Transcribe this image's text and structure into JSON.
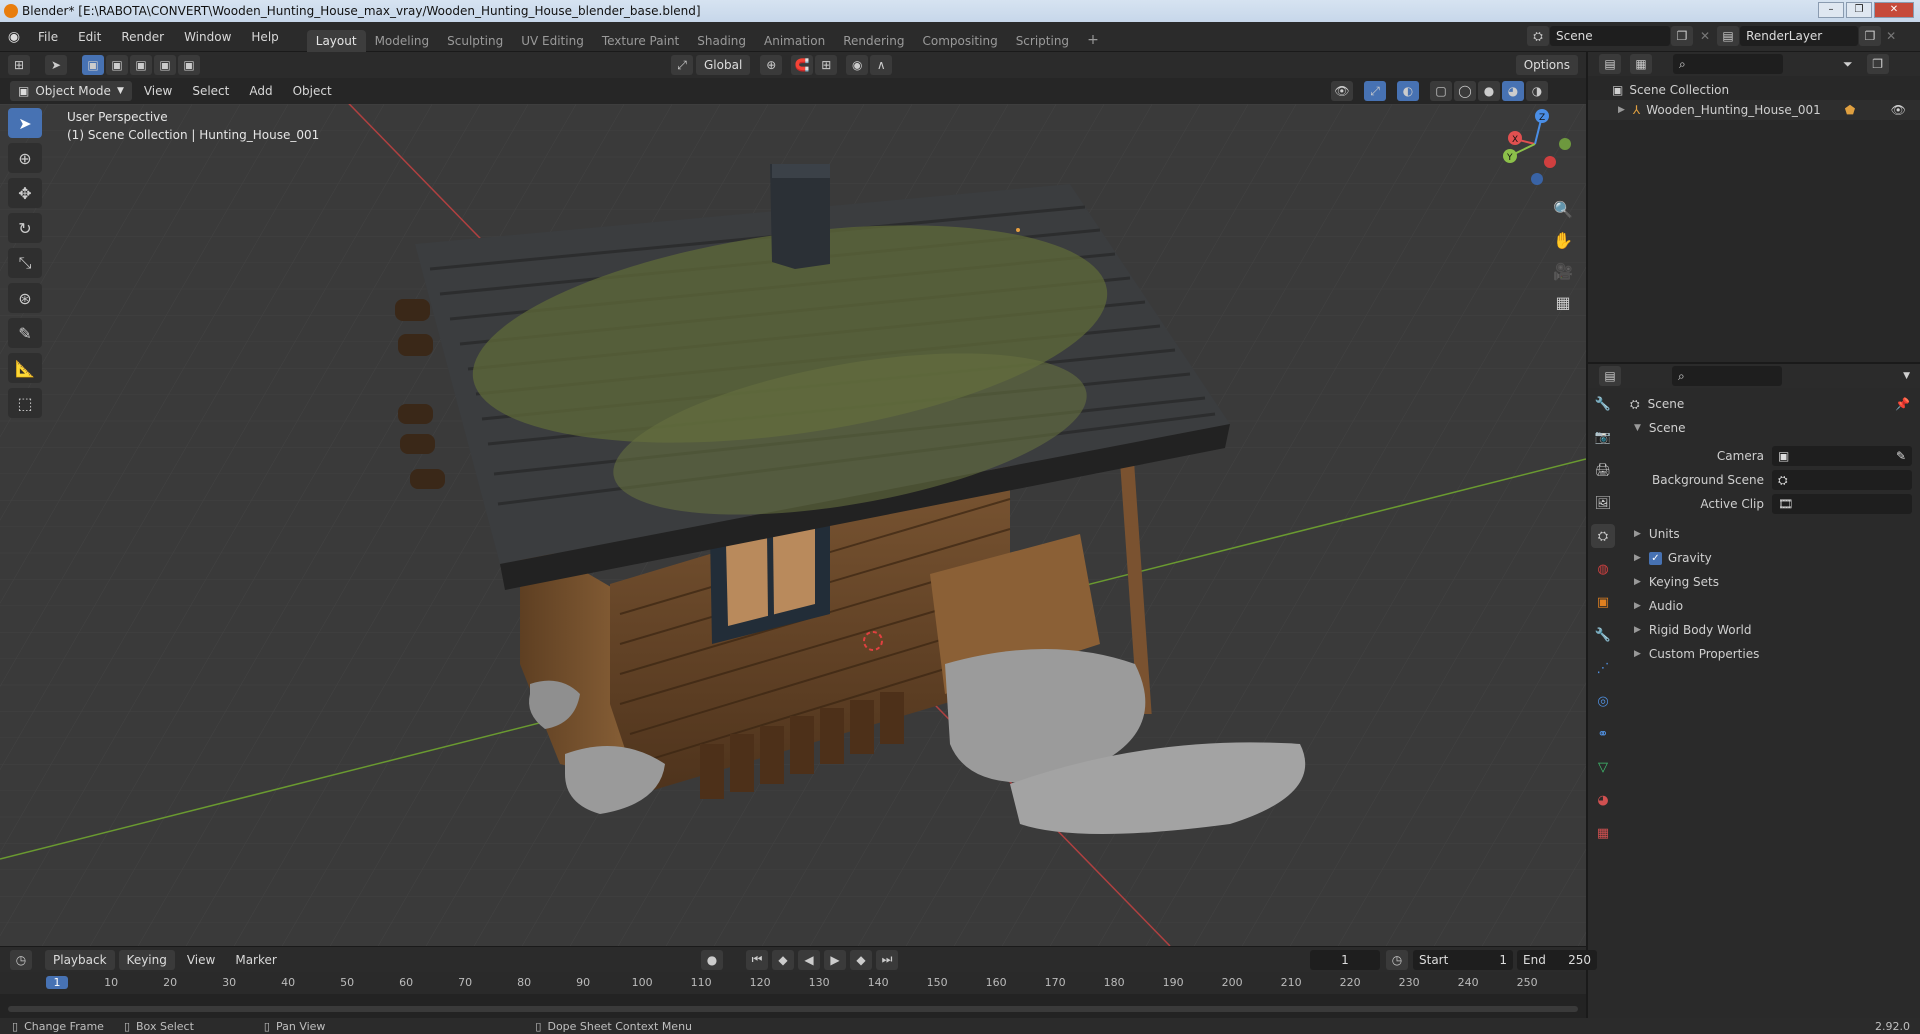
{
  "title_bar": {
    "text": "Blender* [E:\\RABOTA\\CONVERT\\Wooden_Hunting_House_max_vray/Wooden_Hunting_House_blender_base.blend]"
  },
  "menu": [
    "File",
    "Edit",
    "Render",
    "Window",
    "Help"
  ],
  "workspaces": [
    {
      "label": "Layout",
      "active": true
    },
    {
      "label": "Modeling"
    },
    {
      "label": "Sculpting"
    },
    {
      "label": "UV Editing"
    },
    {
      "label": "Texture Paint"
    },
    {
      "label": "Shading"
    },
    {
      "label": "Animation"
    },
    {
      "label": "Rendering"
    },
    {
      "label": "Compositing"
    },
    {
      "label": "Scripting"
    }
  ],
  "scene_field": "Scene",
  "renderlayer_field": "RenderLayer",
  "viewport_header": {
    "transform_orientation": "Global",
    "options_label": "Options"
  },
  "viewport_header2": {
    "mode": "Object Mode",
    "menus": [
      "View",
      "Select",
      "Add",
      "Object"
    ]
  },
  "viewport": {
    "perspective_label": "User Perspective",
    "collection_label": "(1) Scene Collection | Hunting_House_001"
  },
  "gizmo": {
    "x": "X",
    "y": "Y",
    "z": "Z"
  },
  "outliner": {
    "root": "Scene Collection",
    "items": [
      {
        "label": "Wooden_Hunting_House_001"
      }
    ]
  },
  "properties": {
    "context_title": "Scene",
    "panel_title": "Scene",
    "fields": [
      {
        "label": "Camera"
      },
      {
        "label": "Background Scene"
      },
      {
        "label": "Active Clip"
      }
    ],
    "sections": [
      {
        "label": "Units"
      },
      {
        "label": "Gravity",
        "checkbox": true
      },
      {
        "label": "Keying Sets"
      },
      {
        "label": "Audio"
      },
      {
        "label": "Rigid Body World"
      },
      {
        "label": "Custom Properties"
      }
    ]
  },
  "timeline": {
    "menus": [
      "Playback",
      "Keying",
      "View",
      "Marker"
    ],
    "current_frame": "1",
    "start_label": "Start",
    "start_value": "1",
    "end_label": "End",
    "end_value": "250",
    "ticks": [
      "1",
      "10",
      "20",
      "30",
      "40",
      "50",
      "60",
      "70",
      "80",
      "90",
      "100",
      "110",
      "120",
      "130",
      "140",
      "150",
      "160",
      "170",
      "180",
      "190",
      "200",
      "210",
      "220",
      "230",
      "240",
      "250"
    ]
  },
  "statusbar": {
    "items": [
      "Change Frame",
      "Box Select",
      "Pan View",
      "Dope Sheet Context Menu"
    ],
    "version": "2.92.0"
  },
  "colors": {
    "accent": "#4772b3",
    "x_axis": "#e05050",
    "y_axis": "#8cc04a",
    "z_axis": "#4a8ee6"
  }
}
